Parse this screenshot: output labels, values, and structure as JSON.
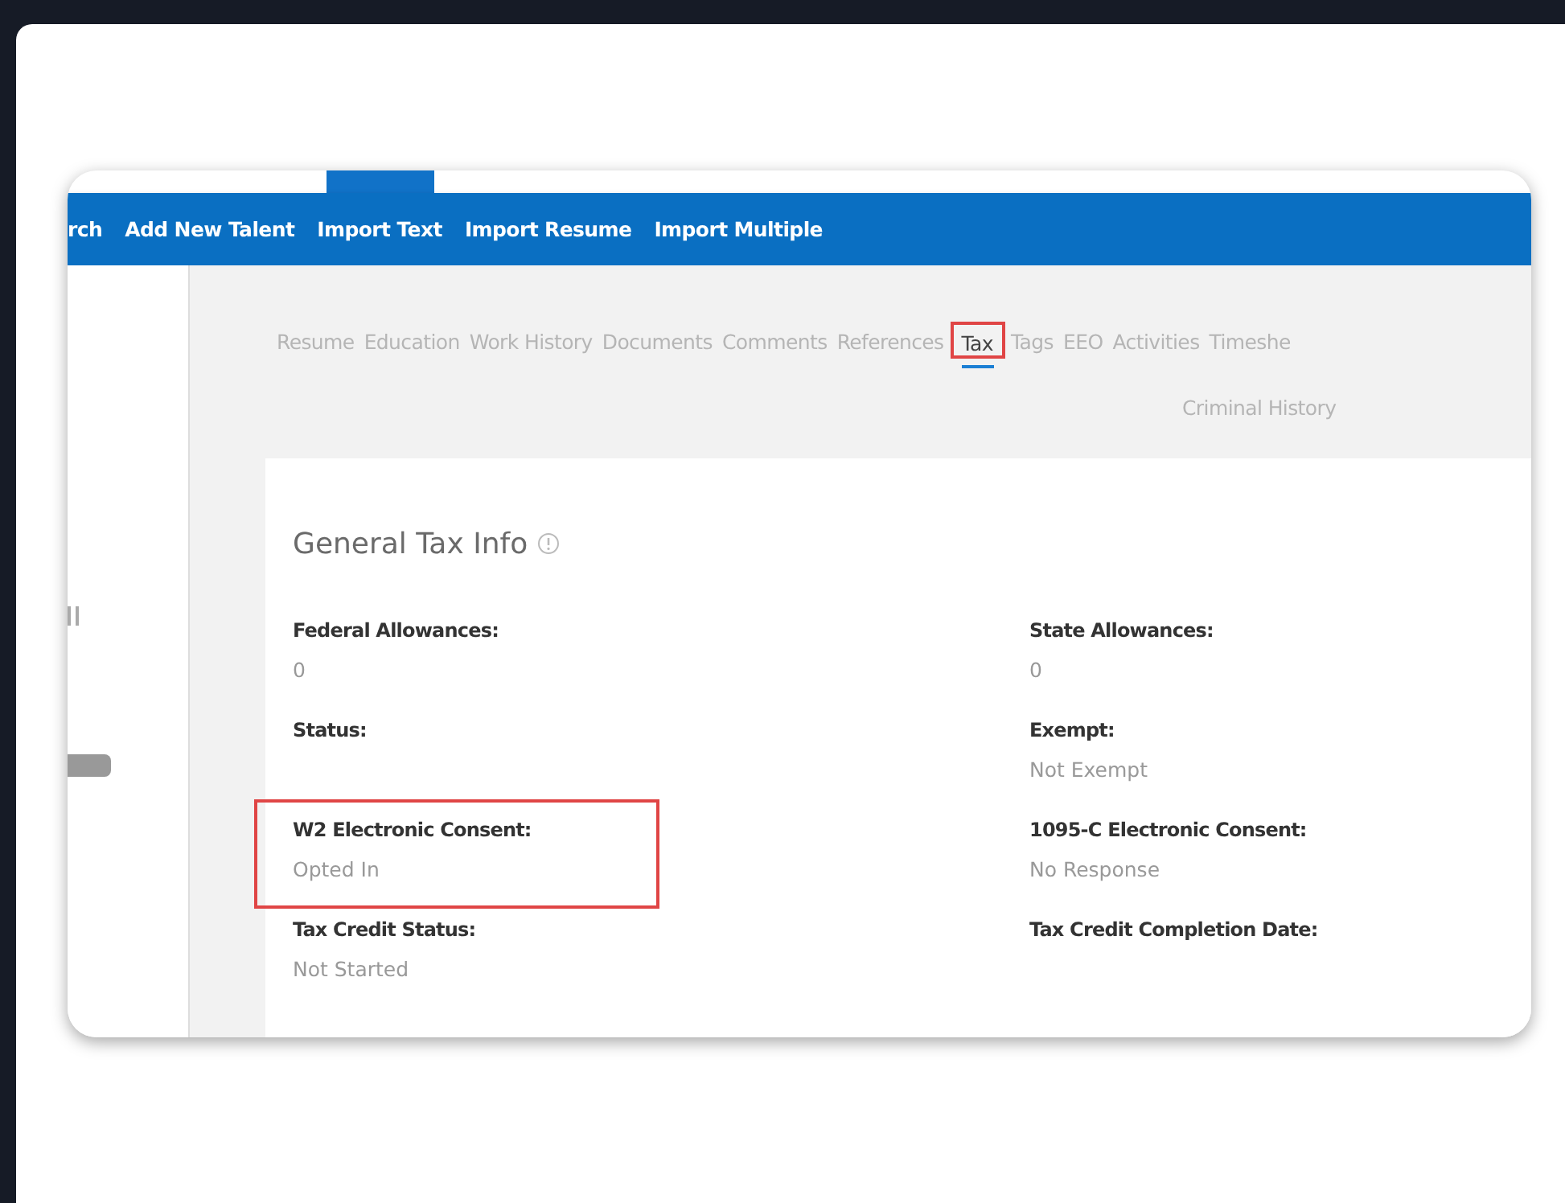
{
  "nav": {
    "items": [
      {
        "label": "rch"
      },
      {
        "label": "Add New Talent"
      },
      {
        "label": "Import Text"
      },
      {
        "label": "Import Resume"
      },
      {
        "label": "Import Multiple"
      }
    ]
  },
  "tab_rows": [
    [
      {
        "label": "Resume",
        "selected": false,
        "highlighted": false
      },
      {
        "label": "Education",
        "selected": false,
        "highlighted": false
      },
      {
        "label": "Work History",
        "selected": false,
        "highlighted": false
      },
      {
        "label": "Documents",
        "selected": false,
        "highlighted": false
      },
      {
        "label": "Comments",
        "selected": false,
        "highlighted": false
      },
      {
        "label": "References",
        "selected": false,
        "highlighted": false
      },
      {
        "label": "Tax",
        "selected": true,
        "highlighted": true
      },
      {
        "label": "Tags",
        "selected": false,
        "highlighted": false
      },
      {
        "label": "EEO",
        "selected": false,
        "highlighted": false
      },
      {
        "label": "Activities",
        "selected": false,
        "highlighted": false
      },
      {
        "label": "Timeshe",
        "selected": false,
        "highlighted": false
      }
    ],
    [
      {
        "label": "Criminal History",
        "selected": false,
        "highlighted": false
      }
    ]
  ],
  "panel": {
    "title": "General Tax Info",
    "fields": [
      {
        "label": "Federal Allowances:",
        "value": "0",
        "highlighted": false
      },
      {
        "label": "State Allowances:",
        "value": "0",
        "highlighted": false
      },
      {
        "label": "Status:",
        "highlighted": false
      },
      {
        "label": "Exempt:",
        "value": "Not Exempt",
        "highlighted": false
      },
      {
        "label": "W2 Electronic Consent:",
        "value": "Opted In",
        "highlighted": true
      },
      {
        "label": "1095-C Electronic Consent:",
        "value": "No Response",
        "highlighted": false
      },
      {
        "label": "Tax Credit Status:",
        "value": "Not Started",
        "highlighted": false
      },
      {
        "label": "Tax Credit Completion Date:",
        "highlighted": false
      }
    ]
  }
}
